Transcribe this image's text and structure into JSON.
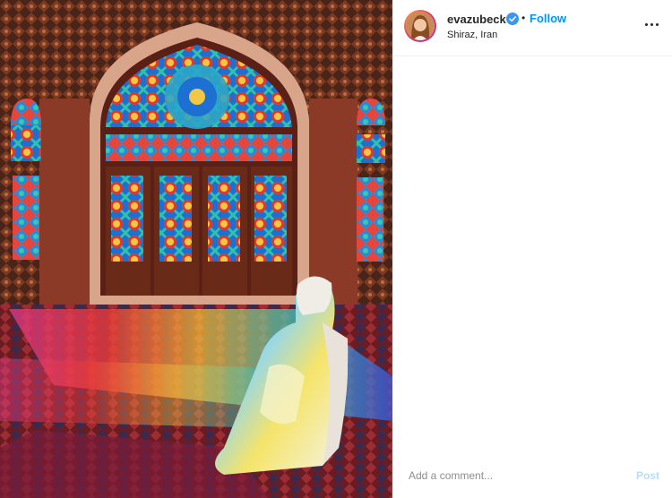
{
  "header": {
    "username": "evazubeck",
    "separator": "•",
    "follow_label": "Follow",
    "location": "Shiraz, Iran"
  },
  "comment": {
    "placeholder": "Add a comment...",
    "post_label": "Post"
  },
  "icons": {
    "verified": "verified-badge-icon",
    "more": "more-options-icon"
  },
  "colors": {
    "link_blue": "#0095f6",
    "post_disabled": "#b2dffc",
    "verified_blue": "#3897f0"
  }
}
